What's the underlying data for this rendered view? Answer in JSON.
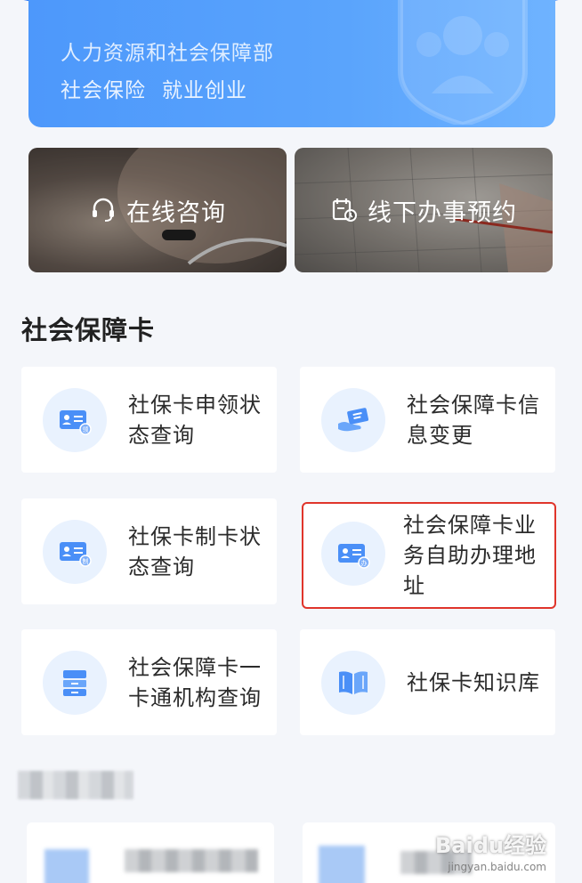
{
  "hero": {
    "department": "人力资源和社会保障部",
    "tag_1": "社会保险",
    "tag_2": "就业创业"
  },
  "banners": {
    "consult_label": "在线咨询",
    "appoint_label": "线下办事预约"
  },
  "section": {
    "title": "社会保障卡"
  },
  "cards": [
    {
      "label": "社保卡申领状态查询",
      "icon": "id-card-apply-icon"
    },
    {
      "label": "社会保障卡信息变更",
      "icon": "card-in-hand-icon"
    },
    {
      "label": "社保卡制卡状态查询",
      "icon": "id-card-make-icon"
    },
    {
      "label": "社会保障卡业务自助办理地址",
      "icon": "id-card-handle-icon"
    },
    {
      "label": "社会保障卡一卡通机构查询",
      "icon": "cabinet-icon"
    },
    {
      "label": "社保卡知识库",
      "icon": "book-icon"
    }
  ],
  "colors": {
    "accent": "#1d6ef5",
    "hero": "#5aa4fc",
    "highlight": "#e0352b",
    "icon_bg": "#e9f2fe",
    "icon_fg": "#4a8ff7"
  },
  "watermark": {
    "brand": "Baidu经验",
    "url": "jingyan.baidu.com"
  }
}
